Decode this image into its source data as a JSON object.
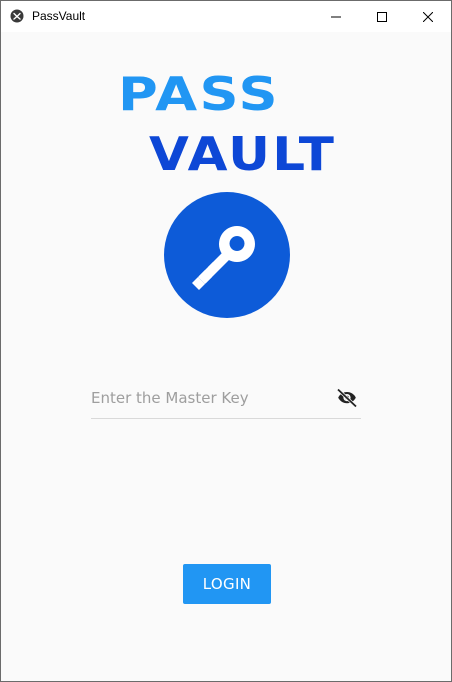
{
  "window": {
    "title": "PassVault",
    "app_icon": "kivy-icon",
    "controls": {
      "minimize_icon": "minimize-icon",
      "maximize_icon": "maximize-icon",
      "close_icon": "close-icon"
    }
  },
  "logo": {
    "line1": "PASS",
    "line2": "VAULT",
    "line1_color": "#2196f3",
    "line2_color": "#0d47d6"
  },
  "key_badge": {
    "icon": "key-icon",
    "color": "#0d5bd8"
  },
  "master_key": {
    "placeholder": "Enter the Master Key",
    "value": "",
    "toggle_icon": "eye-off-icon"
  },
  "login": {
    "label": "LOGIN",
    "color": "#2196f3"
  }
}
